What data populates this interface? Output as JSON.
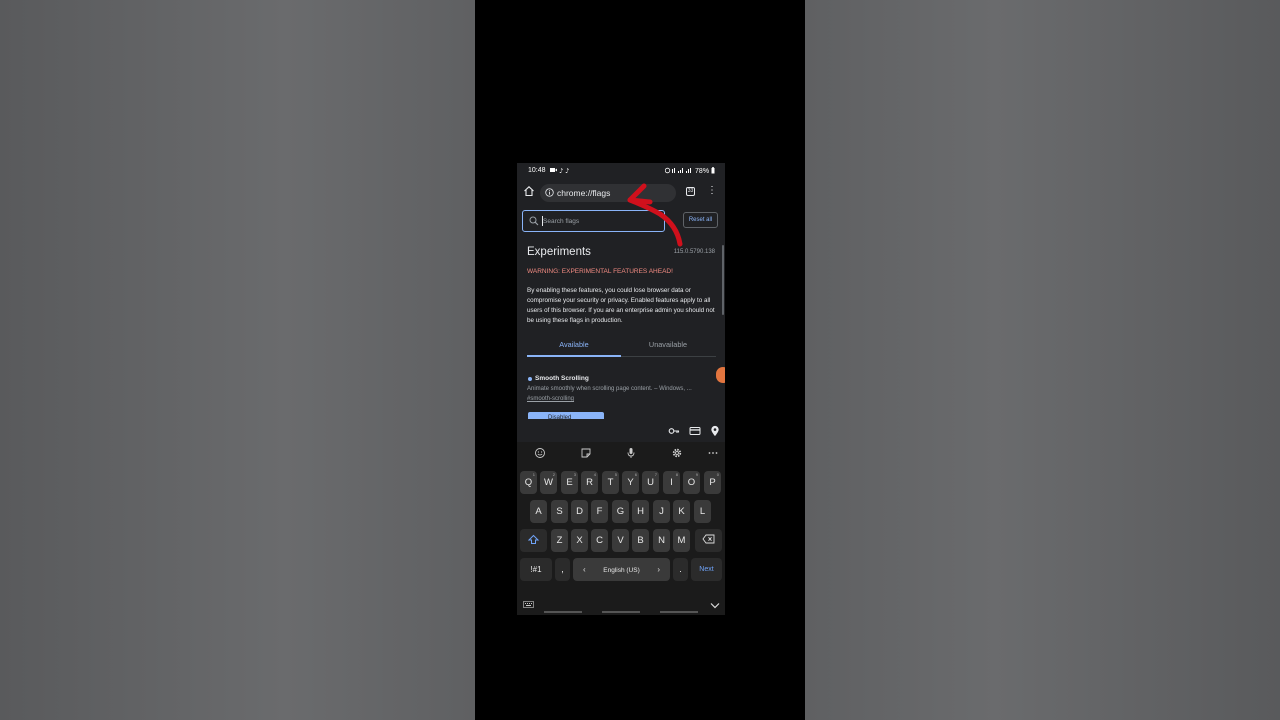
{
  "status_bar": {
    "time": "10:48",
    "icons": [
      "camera-icon",
      "tiktok-icon",
      "tiktok-icon"
    ],
    "right_text": "78%"
  },
  "url_bar": {
    "url": "chrome://flags",
    "tabs_count": "33"
  },
  "search": {
    "placeholder": "Search flags",
    "reset_label": "Reset all"
  },
  "page": {
    "title": "Experiments",
    "version": "115.0.5790.138",
    "warning": "WARNING: EXPERIMENTAL FEATURES AHEAD!",
    "description": "By enabling these features, you could lose browser data or compromise your security or privacy. Enabled features apply to all users of this browser. If you are an enterprise admin you should not be using these flags in production."
  },
  "tabs": [
    {
      "label": "Available",
      "active": true
    },
    {
      "label": "Unavailable",
      "active": false
    }
  ],
  "flag": {
    "title": "Smooth Scrolling",
    "description": "Animate smoothly when scrolling page content. – Windows, ...",
    "link": "#smooth-scrolling",
    "select_value": "Disabled"
  },
  "keyboard": {
    "row1": [
      {
        "key": "Q",
        "hint": "1"
      },
      {
        "key": "W",
        "hint": "2"
      },
      {
        "key": "E",
        "hint": "3"
      },
      {
        "key": "R",
        "hint": "4"
      },
      {
        "key": "T",
        "hint": "5"
      },
      {
        "key": "Y",
        "hint": "6"
      },
      {
        "key": "U",
        "hint": "7"
      },
      {
        "key": "I",
        "hint": "8"
      },
      {
        "key": "O",
        "hint": "9"
      },
      {
        "key": "P",
        "hint": "0"
      }
    ],
    "row2": [
      "A",
      "S",
      "D",
      "F",
      "G",
      "H",
      "J",
      "K",
      "L"
    ],
    "row3": [
      "Z",
      "X",
      "C",
      "V",
      "B",
      "N",
      "M"
    ],
    "symbols_label": "!#1",
    "comma": ",",
    "space_label": "English (US)",
    "period": ".",
    "next_label": "Next"
  },
  "colors": {
    "accent": "#8ab4f8",
    "warning": "#f28b82",
    "annotation_arrow": "#d0101c"
  }
}
